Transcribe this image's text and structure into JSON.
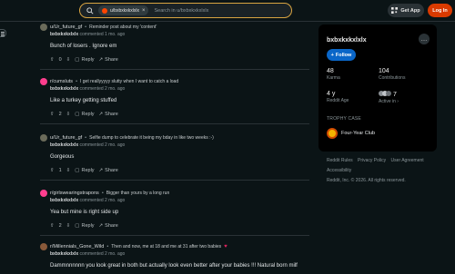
{
  "header": {
    "search_chip": "u/bxbxkxkxlxlx",
    "search_placeholder": "Search in u/bxbxkxkxlxlx",
    "get_app_label": "Get App",
    "login_label": "Log In"
  },
  "comments": [
    {
      "subreddit": "u/Ur_future_gf",
      "post_title": "Reminder post about my 'content'",
      "author": "bxbxkxkxlxlx",
      "time": "commented 1 mo. ago",
      "text": "Bunch of losers . Ignore em",
      "votes": "0",
      "reply": "Reply",
      "share": "Share"
    },
    {
      "subreddit": "r/cumsluts",
      "post_title": "I get reallyyyyy slutty when I want to catch a load",
      "author": "bxbxkxkxlxlx",
      "time": "commented 2 mo. ago",
      "text": "Like a turkey getting stuffed",
      "votes": "2",
      "reply": "Reply",
      "share": "Share"
    },
    {
      "subreddit": "u/Ur_future_gf",
      "post_title": "Selfie dump to celebrate it being my bday in like two weeks :-)",
      "author": "bxbxkxkxlxlx",
      "time": "commented 2 mo. ago",
      "text": "Gorgeous",
      "votes": "1",
      "reply": "Reply",
      "share": "Share"
    },
    {
      "subreddit": "r/girlswearingstrapons",
      "post_title": "Bigger than yours by a long run",
      "author": "bxbxkxkxlxlx",
      "time": "commented 2 mo. ago",
      "text": "Yea but mine is right side up",
      "votes": "2",
      "reply": "Reply",
      "share": "Share"
    },
    {
      "subreddit": "r/Millennials_Gone_Wild",
      "post_title": "Then and now, me at 18 and me at 31 after two babies",
      "author": "bxbxkxkxlxlx",
      "time": "commented 2 mo. ago",
      "text": "Dammnnnnnn you look great in both but actually look even better after your babies !!! Natural born milf"
    }
  ],
  "sidebar": {
    "username": "bxbxkxkxlxlx",
    "follow_label": "Follow",
    "karma_value": "48",
    "karma_label": "Karma",
    "contrib_value": "104",
    "contrib_label": "Contributions",
    "age_value": "4 y",
    "age_label": "Reddit Age",
    "active_value": "7",
    "active_label": "Active in ›",
    "trophy_heading": "TROPHY CASE",
    "trophy_name": "Four-Year Club"
  },
  "footer": {
    "rules": "Reddit Rules",
    "privacy": "Privacy Policy",
    "agreement": "User Agreement",
    "accessibility": "Accessibility",
    "copyright": "Reddit, Inc. © 2026. All rights reserved."
  },
  "colors": {
    "background": "#0b1416",
    "accent_login": "#d93a00",
    "follow_blue": "#0a66c8",
    "search_border": "#d9a441"
  }
}
